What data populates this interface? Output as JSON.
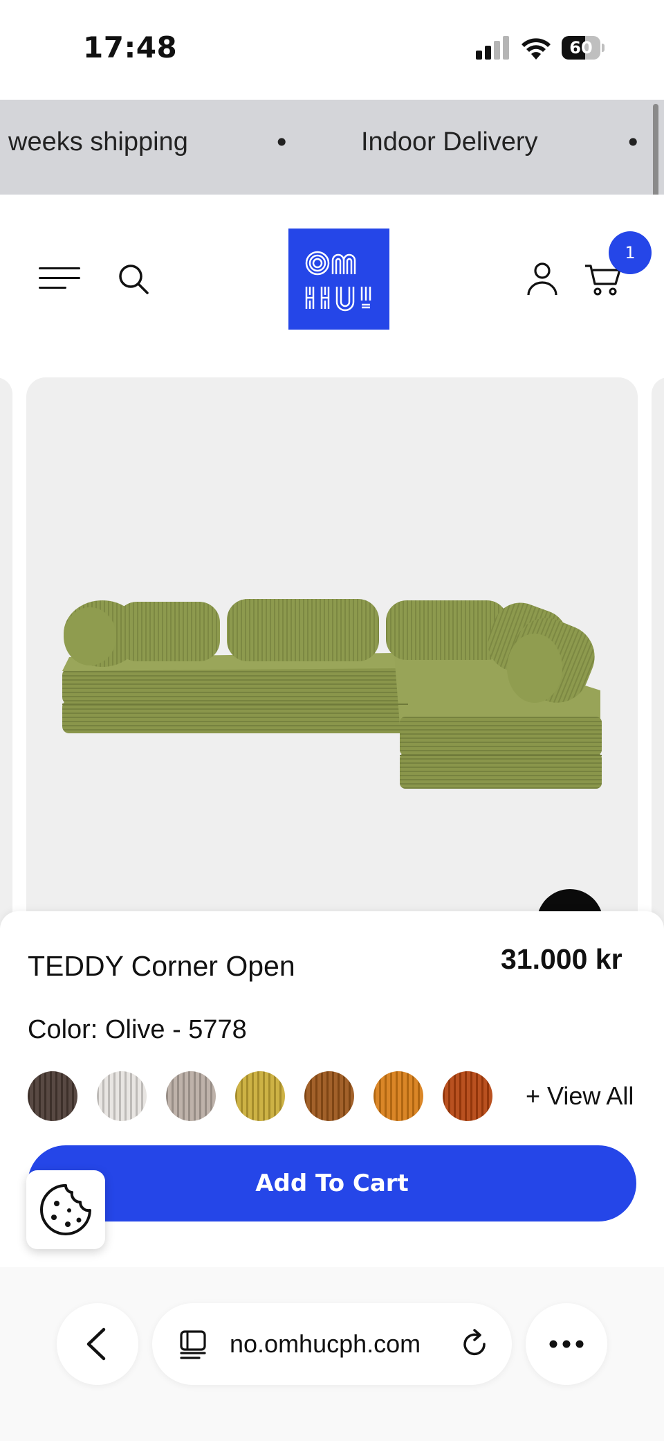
{
  "status_bar": {
    "time": "17:48",
    "battery": "60",
    "battery_level": 0.6
  },
  "announcement": {
    "items": [
      "weeks shipping",
      "Indoor Delivery"
    ],
    "separator": "•"
  },
  "header": {
    "logo_text": "OMHU!",
    "cart_count": "1"
  },
  "product": {
    "title": "TEDDY Corner Open",
    "price": "31.000 kr",
    "color_label": "Color:",
    "color_value": "Olive - 5778",
    "swatches": [
      {
        "name": "dark-brown",
        "color": "#4a3a33"
      },
      {
        "name": "off-white",
        "color": "#e6e3df"
      },
      {
        "name": "taupe",
        "color": "#b8aca3"
      },
      {
        "name": "mustard",
        "color": "#c9ab35"
      },
      {
        "name": "rust-brown",
        "color": "#9a5418"
      },
      {
        "name": "orange",
        "color": "#d77c15"
      },
      {
        "name": "burnt-orange",
        "color": "#b3420d"
      }
    ],
    "view_all_label": "+ View All",
    "add_to_cart_label": "Add To Cart"
  },
  "browser": {
    "url": "no.omhucph.com"
  },
  "colors": {
    "accent": "#2546e8",
    "announcement_bg": "#d4d5d9",
    "image_bg": "#efefef",
    "sofa": "#8d9a4e"
  },
  "icons": [
    "menu-icon",
    "search-icon",
    "account-icon",
    "cart-icon",
    "cookie-icon",
    "back-icon",
    "tabs-icon",
    "reload-icon",
    "more-icon"
  ]
}
